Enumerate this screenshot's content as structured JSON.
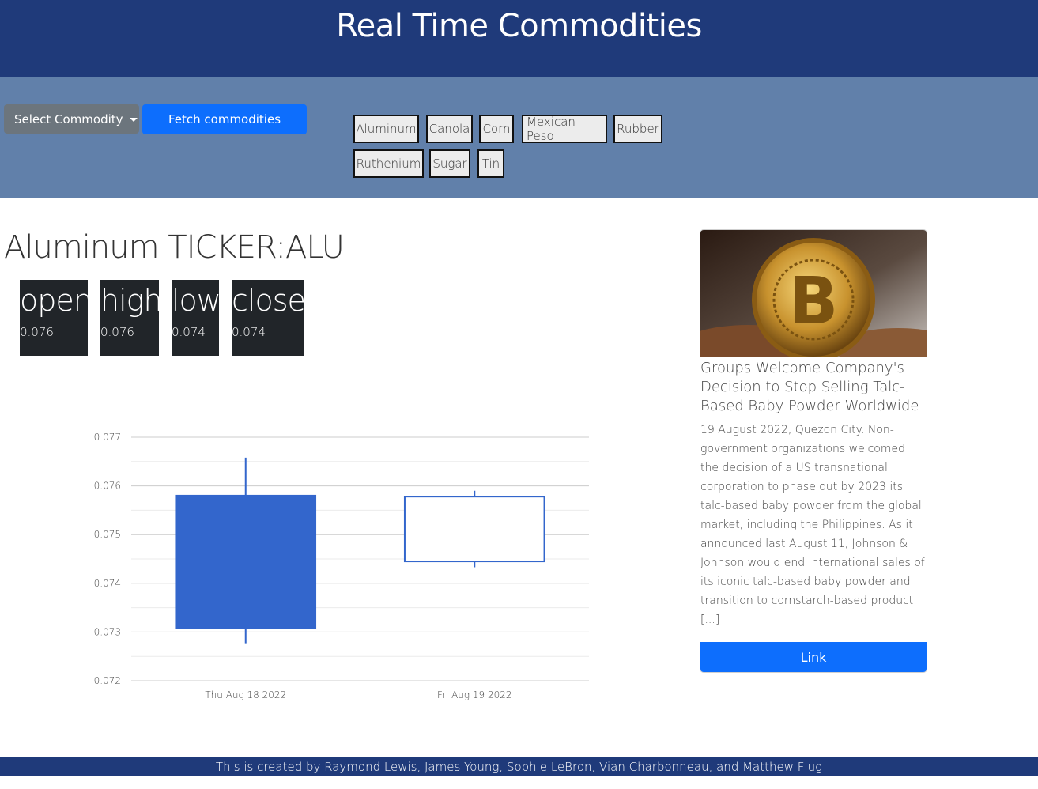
{
  "header": {
    "title": "Real Time Commodities"
  },
  "controls": {
    "select_label": "Select Commodity",
    "fetch_label": "Fetch commodities",
    "chips": [
      "Aluminum",
      "Canola",
      "Corn",
      "Mexican Peso",
      "Rubber",
      "Ruthenium",
      "Sugar",
      "Tin"
    ]
  },
  "commodity": {
    "title": "Aluminum TICKER:ALU",
    "stats": [
      {
        "label": "open",
        "value": "0.076"
      },
      {
        "label": "high",
        "value": "0.076"
      },
      {
        "label": "low",
        "value": "0.074"
      },
      {
        "label": "close",
        "value": "0.074"
      }
    ]
  },
  "chart_data": {
    "type": "candlestick",
    "categories": [
      "Thu Aug 18 2022",
      "Fri Aug 19 2022"
    ],
    "candles": [
      {
        "x": "Thu Aug 18 2022",
        "open": 0.0758,
        "high": 0.07658,
        "low": 0.07277,
        "close": 0.07308
      },
      {
        "x": "Fri Aug 19 2022",
        "open": 0.07445,
        "high": 0.0759,
        "low": 0.07433,
        "close": 0.07578
      }
    ],
    "ylim": [
      0.072,
      0.077
    ],
    "yticks": [
      "0.077",
      "0.076",
      "0.075",
      "0.074",
      "0.073",
      "0.072"
    ],
    "grid": true,
    "colors": {
      "falling": "#3366cc",
      "rising": "#ffffff",
      "stroke": "#3366cc"
    }
  },
  "news": {
    "title": "Groups Welcome Company's Decision to Stop Selling Talc-Based Baby Powder Worldwide",
    "body": "19 August 2022, Quezon City. Non-government organizations welcomed the decision of a US transnational corporation to phase out by 2023 its talc-based baby powder from the global market, including the Philippines. As it announced last August 11, Johnson & Johnson would end international sales of its iconic talc-based baby powder and transition to cornstarch-based product. [...]",
    "link_label": "Link",
    "image": "bitcoin-coin-photo"
  },
  "footer": {
    "text": "This is created by Raymond Lewis, James Young, Sophie LeBron, Vian Charbonneau, and Matthew Flug"
  },
  "colors": {
    "header": "#1f3a7a",
    "controls": "#6180aa",
    "primary": "#0d6efd",
    "stat_bg": "#212529"
  }
}
